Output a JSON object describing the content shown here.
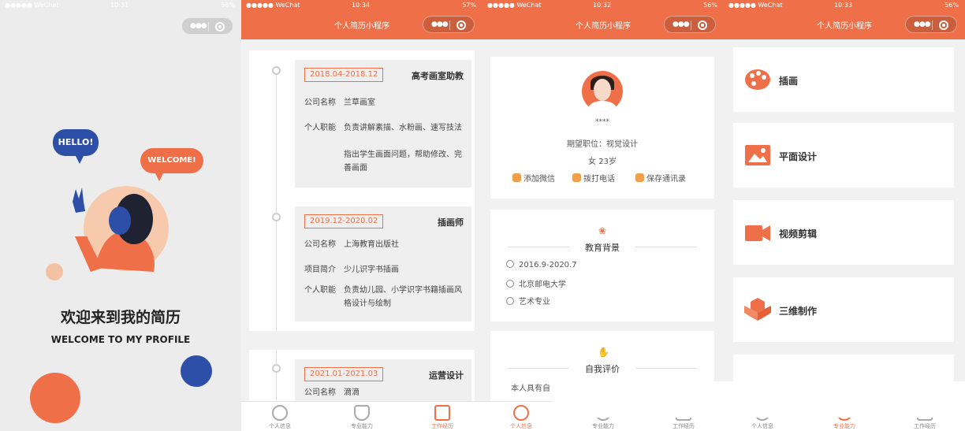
{
  "colors": {
    "accent": "#ef7048",
    "navy": "#2d4fa8",
    "bg": "#f1f1f1"
  },
  "phone1": {
    "status": {
      "carrier": "●●●●● WeChat",
      "time": "10:31",
      "battery": "56%"
    },
    "hello": "HELLO!",
    "welcome_bubble": "WELCOME!",
    "title": "欢迎来到我的简历",
    "subtitle": "WELCOME TO MY PROFILE"
  },
  "phone2": {
    "status": {
      "carrier": "●●●●● WeChat",
      "time": "10:34",
      "battery": "57%"
    },
    "header_title": "个人简历小程序",
    "jobs": [
      {
        "date": "2018.04-2018.12",
        "title": "高考画室助教",
        "rows": [
          {
            "k": "公司名称",
            "v": "兰草画室"
          },
          {
            "k": "个人职能",
            "v": "负责讲解素描、水粉画、速写技法"
          },
          {
            "k": "",
            "v": "指出学生画面问题，帮助修改、完善画面"
          }
        ]
      },
      {
        "date": "2019.12-2020.02",
        "title": "插画师",
        "rows": [
          {
            "k": "公司名称",
            "v": "上海教育出版社"
          },
          {
            "k": "项目简介",
            "v": "少儿识字书插画"
          },
          {
            "k": "个人职能",
            "v": "负责幼儿园、小学识字书籍插画风格设计与绘制"
          }
        ]
      },
      {
        "date": "2021.01-2021.03",
        "title": "运营设计",
        "rows": [
          {
            "k": "公司名称",
            "v": "滴滴"
          }
        ]
      }
    ],
    "tabs": [
      "个人信息",
      "专业能力",
      "工作经历"
    ]
  },
  "phone3": {
    "status": {
      "carrier": "●●●●● WeChat",
      "time": "10:32",
      "battery": "56%"
    },
    "header_title": "个人简历小程序",
    "name": "****",
    "position": "期望职位：视觉设计",
    "gender_age": "女  23岁",
    "actions": [
      "添加微信",
      "拨打电话",
      "保存通讯录"
    ],
    "edu_title": "教育背景",
    "edu": [
      "2016.9-2020.7",
      "北京邮电大学",
      "艺术专业"
    ],
    "self_title": "自我评价",
    "self_text": "本人具有自",
    "tabs": [
      "个人信息",
      "专业能力",
      "工作经历"
    ]
  },
  "phone4": {
    "status": {
      "carrier": "●●●●● WeChat",
      "time": "10:33",
      "battery": "56%"
    },
    "header_title": "个人简历小程序",
    "skills": [
      "插画",
      "平面设计",
      "视频剪辑",
      "三维制作"
    ],
    "tabs": [
      "个人信息",
      "专业能力",
      "工作经历"
    ]
  }
}
